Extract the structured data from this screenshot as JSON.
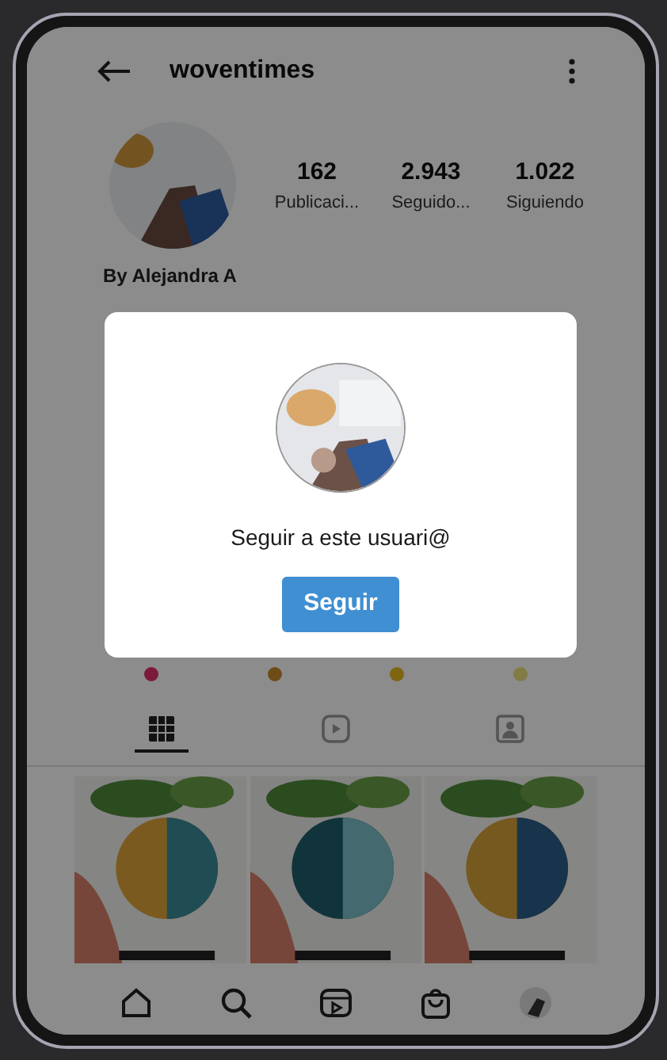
{
  "profile": {
    "username": "woventimes",
    "stats": [
      {
        "value": "162",
        "label": "Publicaci..."
      },
      {
        "value": "2.943",
        "label": "Seguido..."
      },
      {
        "value": "1.022",
        "label": "Siguiendo"
      }
    ],
    "name": "By Alejandra A"
  },
  "highlights": [
    {
      "color": "#7b1a3a"
    },
    {
      "color": "#6e4c17"
    },
    {
      "color": "#7f6511"
    },
    {
      "color": "#827b43"
    }
  ],
  "profile_tabs": [
    {
      "kind": "grid",
      "selected": true
    },
    {
      "kind": "reels",
      "selected": false
    },
    {
      "kind": "tagged",
      "selected": false
    }
  ],
  "dialog": {
    "message": "Seguir a este usuari@",
    "button": "Seguir"
  }
}
